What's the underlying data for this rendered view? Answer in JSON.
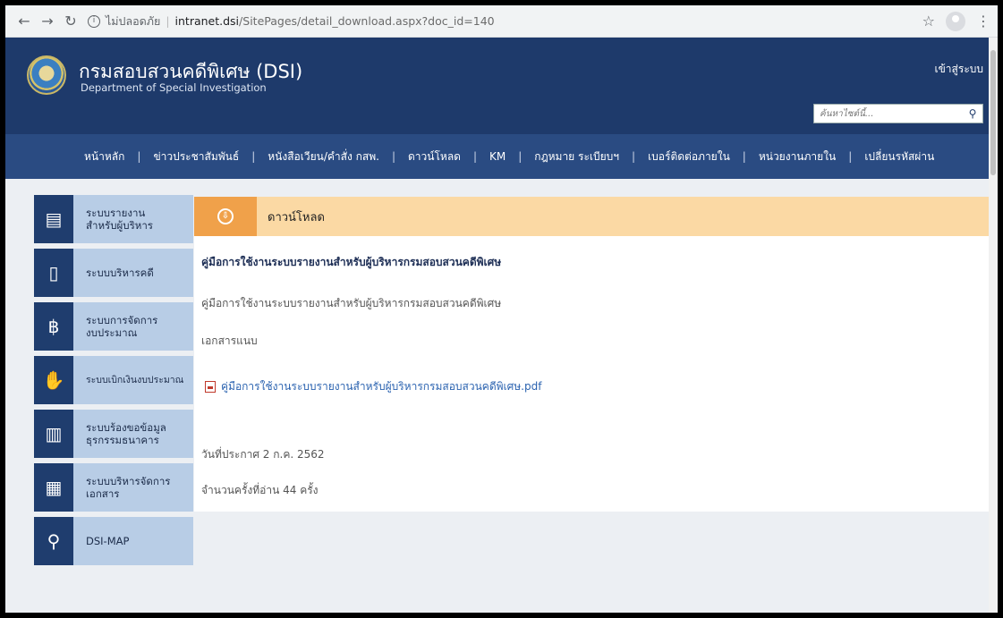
{
  "browser": {
    "security_label": "ไม่ปลอดภัย",
    "url_host": "intranet.dsi",
    "url_path": "/SitePages/detail_download.aspx?doc_id=140"
  },
  "header": {
    "org_thai": "กรมสอบสวนคดีพิเศษ (DSI)",
    "org_english": "Department of Special Investigation",
    "login_label": "เข้าสู่ระบบ",
    "search_placeholder": "ค้นหาไซต์นี้..."
  },
  "nav": {
    "items": [
      "หน้าหลัก",
      "ข่าวประชาสัมพันธ์",
      "หนังสือเวียน/คำสั่ง กสพ.",
      "ดาวน์โหลด",
      "KM",
      "กฎหมาย ระเบียบฯ",
      "เบอร์ติดต่อภายใน",
      "หน่วยงานภายใน",
      "เปลี่ยนรหัสผ่าน"
    ]
  },
  "sidebar": {
    "items": [
      {
        "label1": "ระบบรายงาน",
        "label2": "สำหรับผู้บริหาร",
        "icon": "report-icon"
      },
      {
        "label1": "ระบบบริหารคดี",
        "label2": "",
        "icon": "book-icon"
      },
      {
        "label1": "ระบบการจัดการ",
        "label2": "งบประมาณ",
        "icon": "budget-hand-icon"
      },
      {
        "label1": "ระบบเบิกเงินงบประมาณ",
        "label2": "",
        "icon": "withdraw-hand-icon"
      },
      {
        "label1": "ระบบร้องขอข้อมูล",
        "label2": "ธุรกรรมธนาคาร",
        "icon": "bank-doc-icon"
      },
      {
        "label1": "ระบบบริหารจัดการ",
        "label2": "เอกสาร",
        "icon": "document-icon"
      },
      {
        "label1": "DSI-MAP",
        "label2": "",
        "icon": "map-pin-icon"
      }
    ]
  },
  "download": {
    "heading": "ดาวน์โหลด",
    "doc_title": "คู่มือการใช้งานระบบรายงานสำหรับผู้บริหารกรมสอบสวนคดีพิเศษ",
    "doc_description": "คู่มือการใช้งานระบบรายงานสำหรับผู้บริหารกรมสอบสวนคดีพิเศษ",
    "attachment_label": "เอกสารแนบ",
    "file_name": "คู่มือการใช้งานระบบรายงานสำหรับผู้บริหารกรมสอบสวนคดีพิเศษ.pdf",
    "announce_date": "วันที่ประกาศ 2 ก.ค. 2562",
    "read_count": "จำนวนครั้งที่อ่าน 44 ครั้ง"
  }
}
